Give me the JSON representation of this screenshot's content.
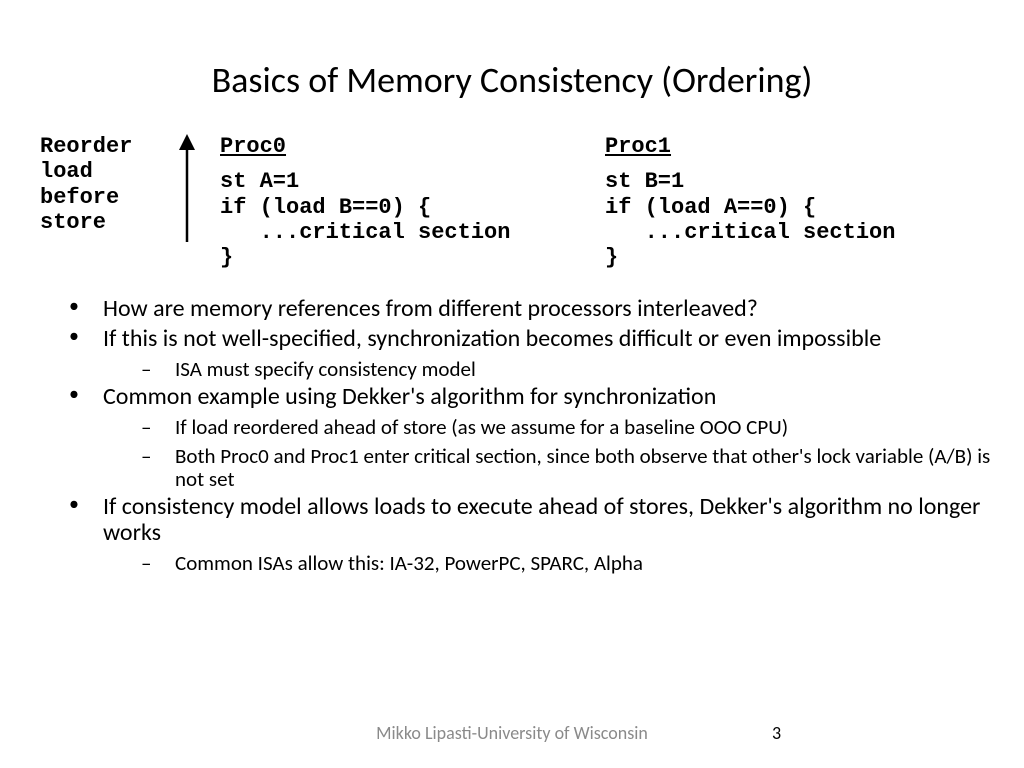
{
  "title": "Basics of Memory Consistency (Ordering)",
  "reorder_label": "Reorder\nload\nbefore\nstore",
  "proc0": {
    "header": "Proc0",
    "body": "st A=1\nif (load B==0) {\n   ...critical section\n}"
  },
  "proc1": {
    "header": "Proc1",
    "body": "st B=1\nif (load A==0) {\n   ...critical section\n}"
  },
  "bullets": {
    "b1": "How are memory references from different processors interleaved?",
    "b2": "If this is not well-specified, synchronization becomes difficult or even impossible",
    "b2a": "ISA must specify consistency model",
    "b3": "Common example using Dekker's algorithm for synchronization",
    "b3a": "If load reordered ahead of store (as we assume for a baseline OOO CPU)",
    "b3b": "Both Proc0 and Proc1 enter critical section, since both observe that other's lock variable (A/B) is not set",
    "b4": "If consistency model allows loads to execute ahead of stores, Dekker's algorithm no longer works",
    "b4a": "Common ISAs allow this: IA-32, PowerPC, SPARC, Alpha"
  },
  "footer": {
    "credit": "Mikko Lipasti-University of Wisconsin",
    "page": "3"
  }
}
